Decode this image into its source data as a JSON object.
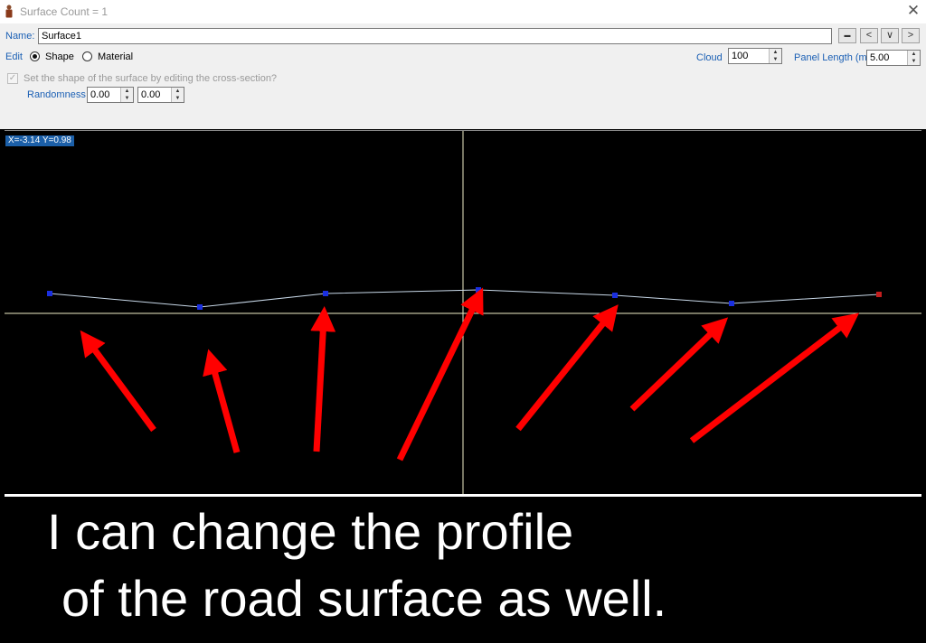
{
  "window": {
    "title": "Surface Count = 1",
    "close_glyph": "✕"
  },
  "form": {
    "name_label": "Name:",
    "name_value": "Surface1",
    "edit_label": "Edit",
    "shape_label": "Shape",
    "material_label": "Material",
    "cloud_label": "Cloud",
    "cloud_value": "100",
    "panel_length_label": "Panel Length (m)",
    "panel_length_value": "5.00",
    "cross_section_label": "Set the shape of the surface by editing the cross-section?",
    "randomness_label": "Randomness",
    "randomness_1": "0.00",
    "randomness_2": "0.00",
    "minus_btn": "▬",
    "prev_btn": "<",
    "dropdown_btn": "∨",
    "next_btn": ">"
  },
  "canvas": {
    "coord_readout": "X=-3.14 Y=0.98"
  },
  "caption": {
    "line1": "I can change the profile",
    "line2": "of the road surface as well."
  },
  "colors": {
    "profile_line": "#c8d8e8",
    "control_point": "#1a2fe0",
    "end_point": "#c41e1e",
    "arrow": "#ff0000",
    "axis": "#f0eec8"
  }
}
